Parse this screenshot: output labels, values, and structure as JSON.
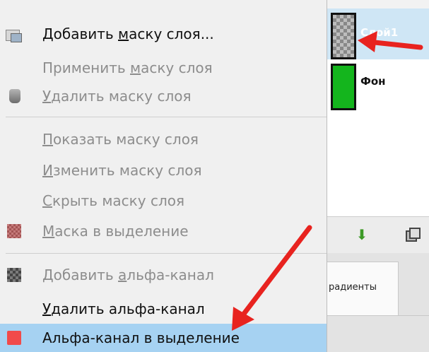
{
  "layers_panel": {
    "layers": [
      {
        "name": "Слой1",
        "selected": true
      },
      {
        "name": "Фон",
        "selected": false
      }
    ],
    "tabs": {
      "gradients_label": "радиенты"
    }
  },
  "context_menu": {
    "items": [
      {
        "label_pre": "Добавить ",
        "label_ul": "м",
        "label_post": "аску слоя...",
        "enabled": true,
        "icon": "add-mask-icon"
      },
      {
        "label_pre": "Применить ",
        "label_ul": "м",
        "label_post": "аску слоя",
        "enabled": false,
        "icon": "none"
      },
      {
        "label_pre": "",
        "label_ul": "У",
        "label_post": "далить маску слоя",
        "enabled": false,
        "icon": "delete-mask-icon"
      },
      {
        "label_pre": "",
        "label_ul": "П",
        "label_post": "оказать маску слоя",
        "enabled": false,
        "icon": "none"
      },
      {
        "label_pre": "",
        "label_ul": "И",
        "label_post": "зменить маску слоя",
        "enabled": false,
        "icon": "none"
      },
      {
        "label_pre": "",
        "label_ul": "С",
        "label_post": "крыть маску слоя",
        "enabled": false,
        "icon": "none"
      },
      {
        "label_pre": "",
        "label_ul": "М",
        "label_post": "аска в выделение",
        "enabled": false,
        "icon": "mask-to-selection-icon"
      },
      {
        "label_pre": "Добавить ",
        "label_ul": "а",
        "label_post": "льфа-канал",
        "enabled": false,
        "icon": "add-alpha-icon"
      },
      {
        "label_pre": "",
        "label_ul": "У",
        "label_post": "далить альфа-канал",
        "enabled": true,
        "icon": "none"
      },
      {
        "label_pre": "Альфа-канал в выделение",
        "label_ul": "",
        "label_post": "",
        "enabled": true,
        "highlighted": true,
        "icon": "alpha-to-selection-icon"
      }
    ]
  },
  "colors": {
    "highlight": "#a6d2f2",
    "arrow": "#e8231f",
    "disabled_text": "#8d8d8d"
  }
}
